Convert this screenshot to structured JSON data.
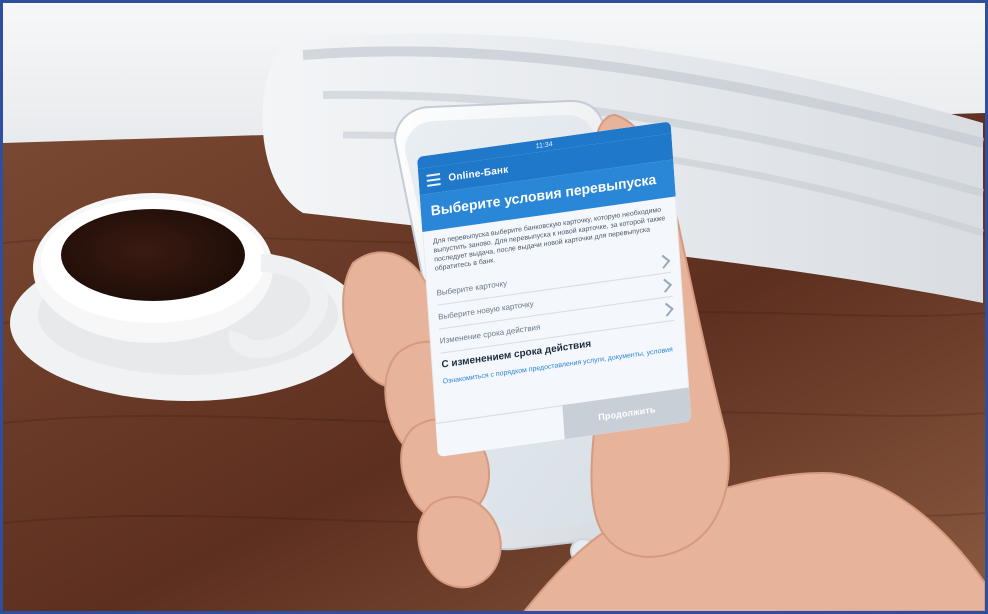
{
  "photo": {
    "background_colors": {
      "wall": "#eef0f2",
      "table": "#6b3a25",
      "cup": "#f4f4f4",
      "coffee": "#2a130c",
      "newspaper": "#e9ecef",
      "phone_frame": "#eceff3",
      "hand": "#e9b7a2",
      "border": "#2f4f9e"
    }
  },
  "phone_app": {
    "status_time": "11:34",
    "app_title": "Online-Банк",
    "header_title": "Выберите условия перевыпуска",
    "description": "Для перевыпуска выберите банковскую карточку, которую необходимо выпустить заново. Для перевыпуска к новой карточке, за которой также последует выдача, после выдачи новой карточки для перевыпуска обратитесь в банк.",
    "fields": [
      {
        "label": "Выберите карточку"
      },
      {
        "label": "Выберите новую карточку"
      },
      {
        "label": "Изменение срока действия"
      }
    ],
    "selected_option": "С изменением срока действия",
    "info_text": "Ознакомиться с порядком предоставления услуги, документы, условия",
    "buttons": {
      "back": "",
      "continue": "Продолжить"
    },
    "colors": {
      "primary": "#1f78c9",
      "header": "#2a86d7"
    },
    "icons": {
      "menu": "hamburger-menu-icon",
      "chevron": "chevron-right-icon"
    }
  }
}
